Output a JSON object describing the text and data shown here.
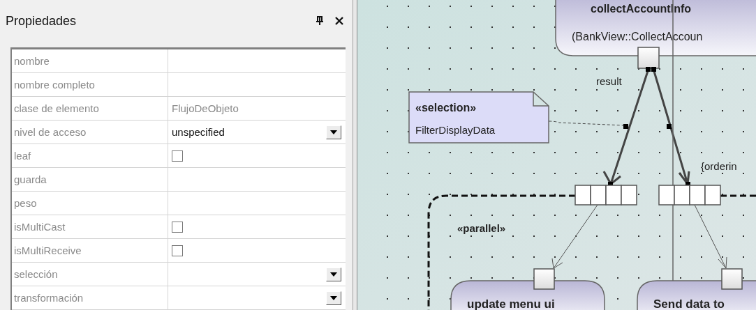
{
  "panel": {
    "title": "Propiedades"
  },
  "properties": [
    {
      "name": "nombre",
      "kind": "text"
    },
    {
      "name": "nombre completo",
      "kind": "text"
    },
    {
      "name": "clase de elemento",
      "kind": "text",
      "value": "FlujoDeObjeto",
      "readonly": true
    },
    {
      "name": "nivel de acceso",
      "kind": "dropdown",
      "value": "unspecified",
      "readonly": false
    },
    {
      "name": "leaf",
      "kind": "checkbox",
      "checked": false
    },
    {
      "name": "guarda",
      "kind": "text"
    },
    {
      "name": "peso",
      "kind": "text"
    },
    {
      "name": "isMultiCast",
      "kind": "checkbox",
      "checked": false
    },
    {
      "name": "isMultiReceive",
      "kind": "checkbox",
      "checked": false
    },
    {
      "name": "selección",
      "kind": "dropdown"
    },
    {
      "name": "transformación",
      "kind": "dropdown"
    }
  ],
  "diagram": {
    "top_action": {
      "title": "collectAccountInfo",
      "operation": "(BankView::CollectAccoun"
    },
    "edge_label": "result",
    "note": {
      "stereotype": "«selection»",
      "text": "FilterDisplayData"
    },
    "constraint": "{orderin",
    "region": {
      "stereotype": "«parallel»"
    },
    "actions": [
      {
        "title": "update menu ui"
      },
      {
        "title": "Send data to"
      }
    ]
  }
}
